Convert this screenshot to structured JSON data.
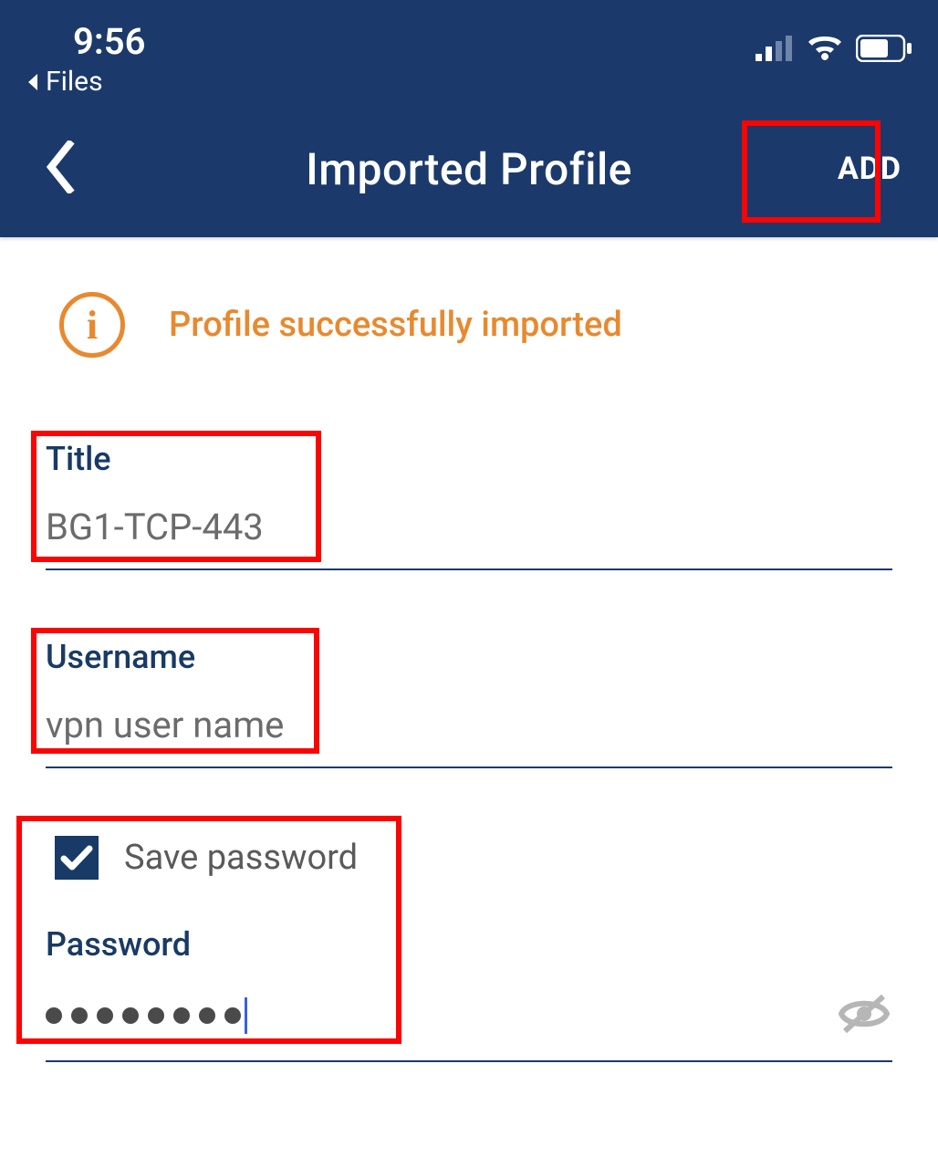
{
  "status": {
    "time": "9:56",
    "back_label": "Files"
  },
  "nav": {
    "title": "Imported Profile",
    "add_label": "ADD"
  },
  "info": {
    "message": "Profile successfully imported"
  },
  "fields": {
    "title": {
      "label": "Title",
      "value": "BG1-TCP-443"
    },
    "username": {
      "label": "Username",
      "value": "vpn user name"
    },
    "save_password_label": "Save password",
    "password": {
      "label": "Password",
      "dot_count": 8
    }
  }
}
